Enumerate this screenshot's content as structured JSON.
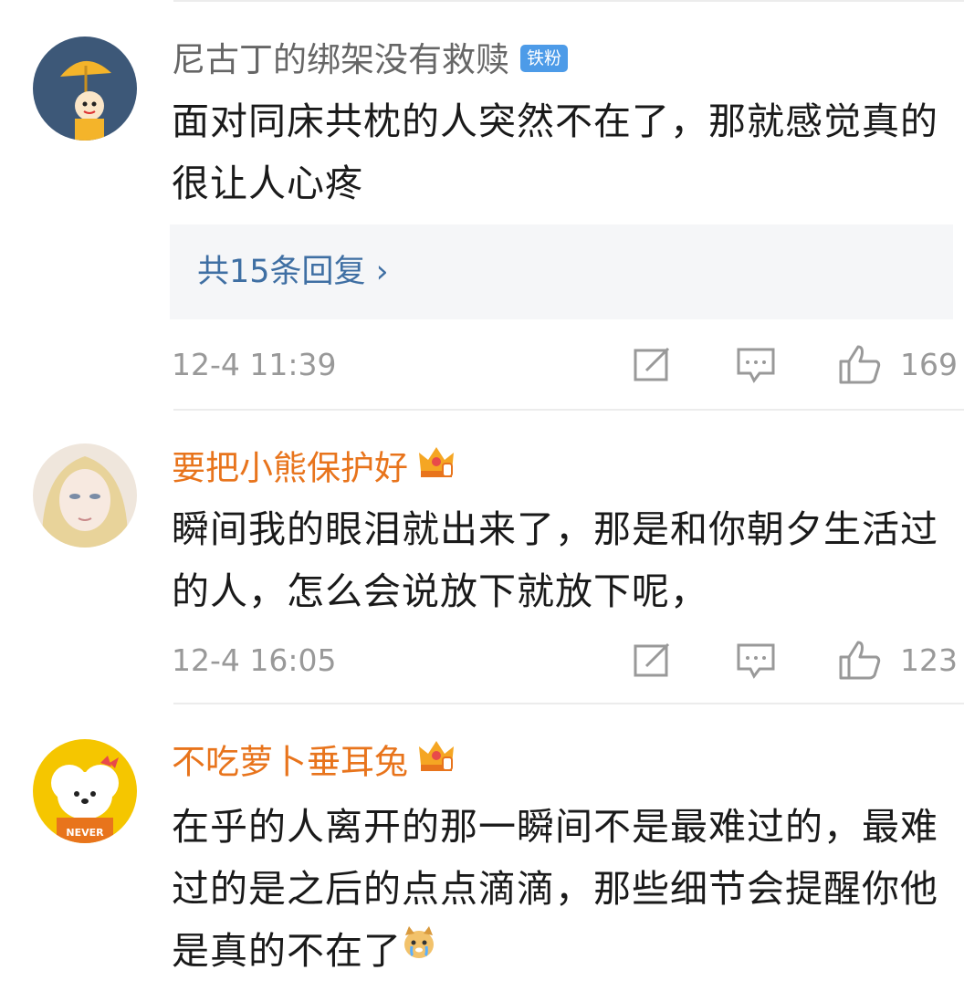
{
  "comments": [
    {
      "username": "尼古丁的绑架没有救赎",
      "username_color": "#666666",
      "badge": "铁粉",
      "text": "面对同床共枕的人突然不在了，那就感觉真的很让人心疼",
      "replies_label": "共15条回复 ›",
      "time": "12-4 11:39",
      "likes": "169"
    },
    {
      "username": "要把小熊保护好",
      "username_color": "#e8741c",
      "badge_icon": "crown-icon",
      "text": "瞬间我的眼泪就出来了，那是和你朝夕生活过的人，怎么会说放下就放下呢，",
      "time": "12-4 16:05",
      "likes": "123"
    },
    {
      "username": "不吃萝卜垂耳兔",
      "username_color": "#e8741c",
      "badge_icon": "crown-icon",
      "text": "在乎的人离开的那一瞬间不是最难过的，最难过的是之后的点点滴滴，那些细节会提醒你他是真的不在了",
      "trailing_icon": "crying-dog-emoji-icon"
    }
  ],
  "colors": {
    "accent": "#e8741c",
    "link": "#3f6fa3",
    "meta": "#999999",
    "badge": "#4d9be8"
  }
}
